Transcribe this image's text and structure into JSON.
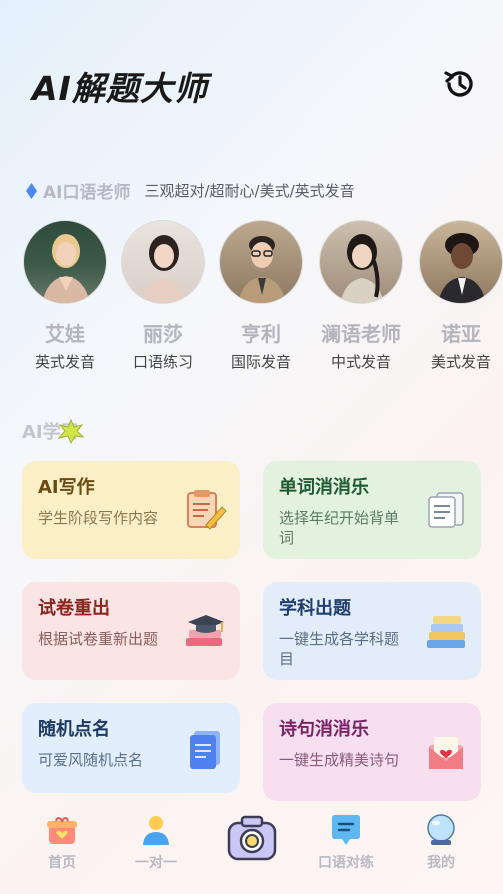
{
  "header": {
    "title": "AI解题大师",
    "history_icon": "history-icon"
  },
  "tutors": {
    "title": "AI口语老师",
    "subtitle": "三观超对/超耐心/美式/英式发音",
    "items": [
      {
        "name": "艾娃",
        "desc": "英式发音"
      },
      {
        "name": "丽莎",
        "desc": "口语练习"
      },
      {
        "name": "亨利",
        "desc": "国际发音"
      },
      {
        "name": "澜语老师",
        "desc": "中式发音"
      },
      {
        "name": "诺亚",
        "desc": "美式发音"
      }
    ]
  },
  "study": {
    "title": "AI学习",
    "cards": [
      {
        "title": "AI写作",
        "desc": "学生阶段写作内容",
        "icon": "clipboard-pencil-icon",
        "bg": "#fbefc7",
        "title_color": "#6b4a12",
        "desc_color": "#8a7650"
      },
      {
        "title": "单词消消乐",
        "desc": "选择年纪开始背单词",
        "icon": "flashcards-icon",
        "bg": "#e2f2df",
        "title_color": "#1f5a35",
        "desc_color": "#5c7a66"
      },
      {
        "title": "试卷重出",
        "desc": "根据试卷重新出题",
        "icon": "graduation-books-icon",
        "bg": "#fbe5e4",
        "title_color": "#8a2520",
        "desc_color": "#8a5c5a"
      },
      {
        "title": "学科出题",
        "desc": "一键生成各学科题目",
        "icon": "book-stack-icon",
        "bg": "#e2edf9",
        "title_color": "#1f3e6e",
        "desc_color": "#5a6d87"
      },
      {
        "title": "随机点名",
        "desc": "可爱风随机点名",
        "icon": "document-icon",
        "bg": "#e3eefc",
        "title_color": "#1d3a63",
        "desc_color": "#586f8c"
      },
      {
        "title": "诗句消消乐",
        "desc": "一键生成精美诗句",
        "icon": "love-letter-icon",
        "bg": "#f7dff0",
        "title_color": "#7a2266",
        "desc_color": "#8a5b7f"
      }
    ]
  },
  "tabbar": {
    "items": [
      {
        "label": "首页",
        "icon": "gift-home-icon"
      },
      {
        "label": "一对一",
        "icon": "person-icon"
      },
      {
        "label": "",
        "icon": "camera-icon"
      },
      {
        "label": "口语对练",
        "icon": "chat-bubble-icon"
      },
      {
        "label": "我的",
        "icon": "crystal-ball-icon"
      }
    ]
  }
}
